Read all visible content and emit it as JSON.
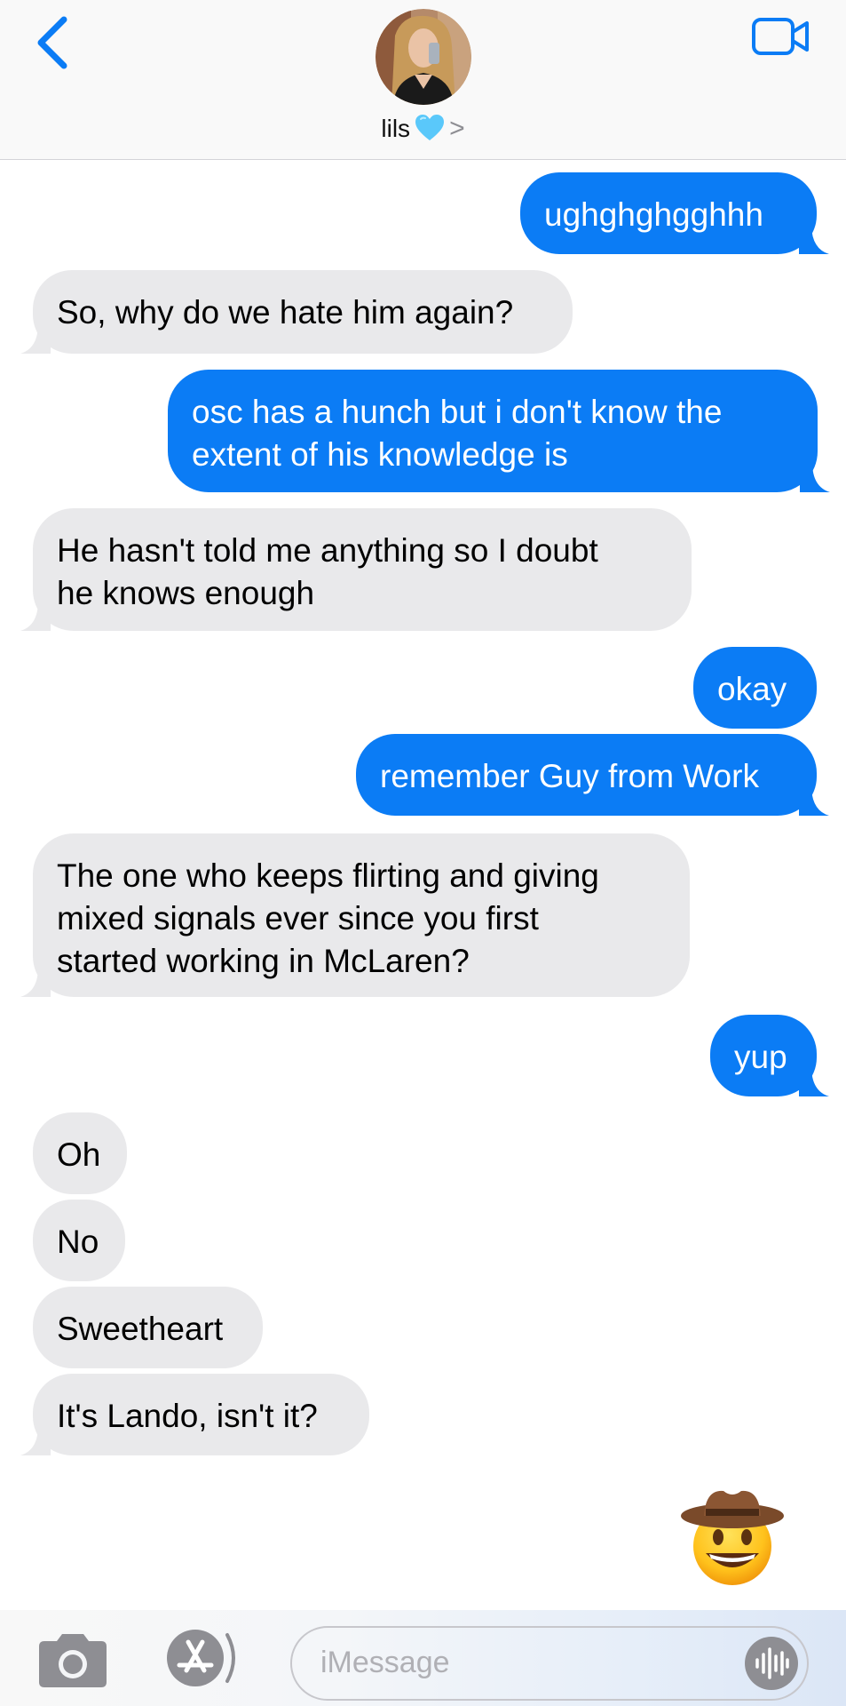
{
  "header": {
    "contact_name": "lils",
    "chevron": ">",
    "back_icon": "chevron-left-icon",
    "video_icon": "video-camera-icon",
    "accent": "#0b7cf5"
  },
  "messages": [
    {
      "side": "out",
      "lines": [
        "ughghghgghhh"
      ]
    },
    {
      "side": "in",
      "lines": [
        "So, why do we hate him again?"
      ]
    },
    {
      "side": "out",
      "lines": [
        "osc has a hunch but i don't know the",
        "extent of his knowledge is"
      ]
    },
    {
      "side": "in",
      "lines": [
        "He hasn't told me anything so I doubt",
        "he knows enough"
      ]
    },
    {
      "side": "out",
      "lines": [
        "okay"
      ]
    },
    {
      "side": "out",
      "lines": [
        "remember Guy from Work"
      ]
    },
    {
      "side": "in",
      "lines": [
        "The one who keeps flirting and giving",
        "mixed signals ever since you first",
        "started working in McLaren?"
      ]
    },
    {
      "side": "out",
      "lines": [
        "yup"
      ]
    },
    {
      "side": "in",
      "lines": [
        "Oh"
      ]
    },
    {
      "side": "in",
      "lines": [
        "No"
      ]
    },
    {
      "side": "in",
      "lines": [
        "Sweetheart"
      ]
    },
    {
      "side": "in",
      "lines": [
        "It's Lando, isn't it?"
      ]
    }
  ],
  "reaction_emoji": "cowboy-hat-face-emoji",
  "composer": {
    "placeholder": "iMessage",
    "camera_icon": "camera-icon",
    "appstore_icon": "app-store-icon",
    "audio_icon": "audio-waveform-icon"
  },
  "colors": {
    "outgoing_bubble": "#0b7cf5",
    "incoming_bubble": "#e9e9eb"
  }
}
